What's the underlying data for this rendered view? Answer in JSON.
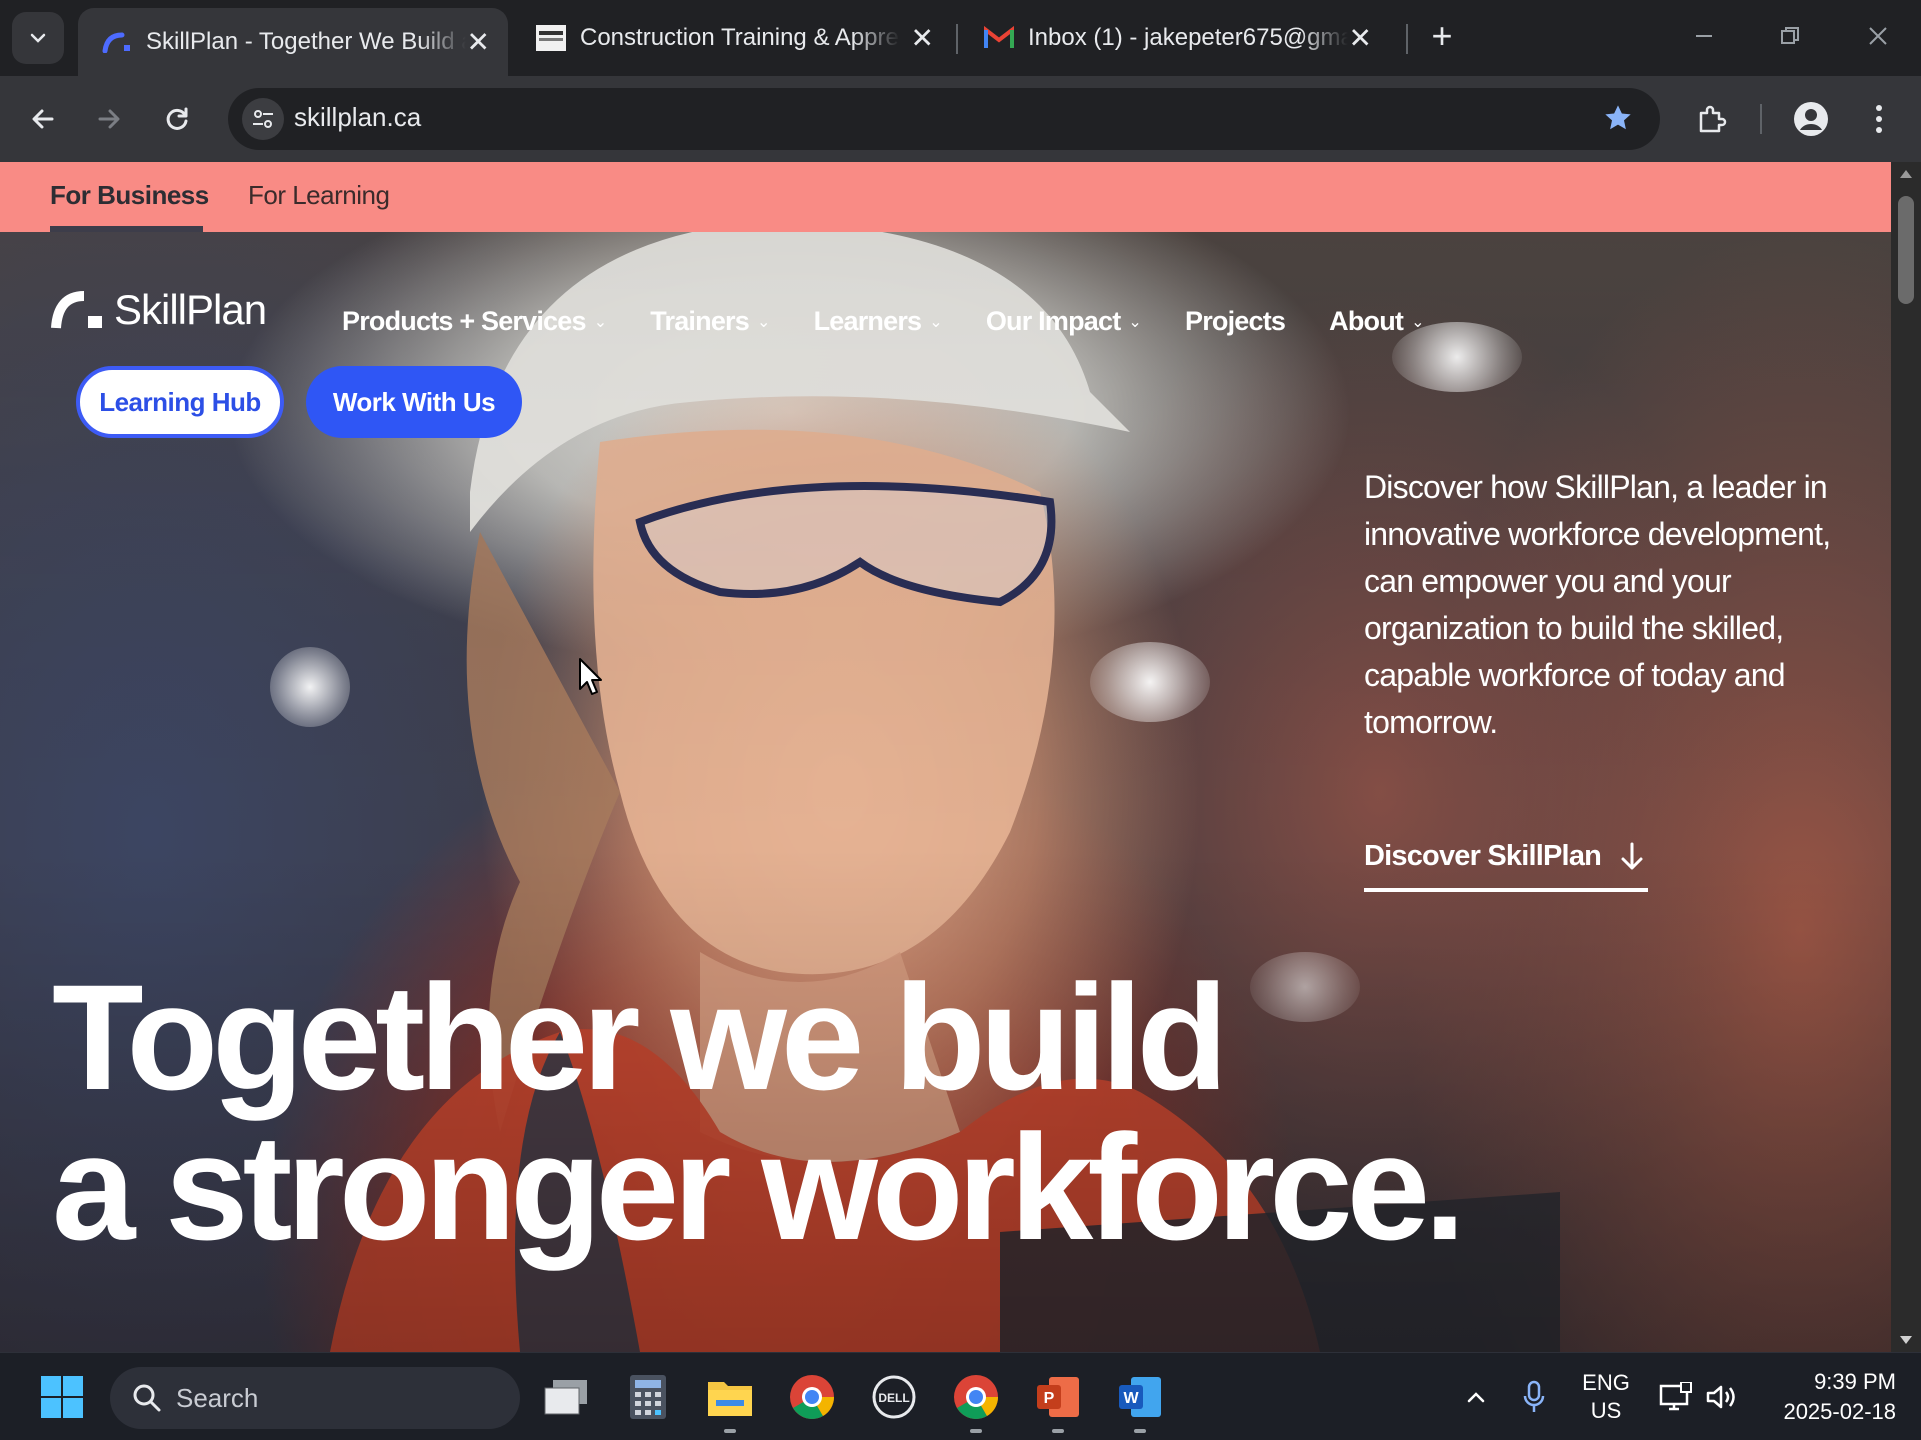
{
  "browser": {
    "tabs": [
      {
        "title": "SkillPlan - Together We Build a ",
        "active": true,
        "favicon": "skillplan-favicon"
      },
      {
        "title": "Construction Training & Appren",
        "active": false,
        "favicon": "ctao-favicon"
      },
      {
        "title": "Inbox (1) - jakepeter675@gmail",
        "active": false,
        "favicon": "gmail-favicon"
      }
    ],
    "close_glyph": "✕",
    "new_tab_glyph": "+",
    "url": "skillplan.ca",
    "bookmarked": true
  },
  "page": {
    "topbar": {
      "segments": [
        {
          "label": "For Business",
          "active": true
        },
        {
          "label": "For Learning",
          "active": false
        }
      ]
    },
    "logo": {
      "text": "SkillPlan"
    },
    "nav": [
      {
        "label": "Products + Services",
        "has_dropdown": true
      },
      {
        "label": "Trainers",
        "has_dropdown": true
      },
      {
        "label": "Learners",
        "has_dropdown": true
      },
      {
        "label": "Our Impact",
        "has_dropdown": true
      },
      {
        "label": "Projects",
        "has_dropdown": false
      },
      {
        "label": "About",
        "has_dropdown": true
      }
    ],
    "dropdown_glyph": "⌄",
    "buttons": {
      "learning_hub": "Learning Hub",
      "work_with_us": "Work With Us"
    },
    "intro": "Discover how SkillPlan, a leader in innovative workforce development, can empower you and your organization to build the skilled, capable workforce of today and tomorrow.",
    "discover_link": "Discover SkillPlan",
    "headline": {
      "line1": "Together we build",
      "line2": "a stronger workforce."
    },
    "colors": {
      "topbar": "#f98b85",
      "primary_blue": "#2f56f5",
      "text_white": "#ffffff"
    }
  },
  "taskbar": {
    "search_label": "Search",
    "apps": [
      "task-view-icon",
      "calculator-icon",
      "file-explorer-icon",
      "chrome-icon",
      "dell-icon",
      "chrome-icon",
      "powerpoint-icon",
      "word-icon"
    ],
    "language_top": "ENG",
    "language_bottom": "US",
    "time": "9:39 PM",
    "date": "2025-02-18"
  }
}
